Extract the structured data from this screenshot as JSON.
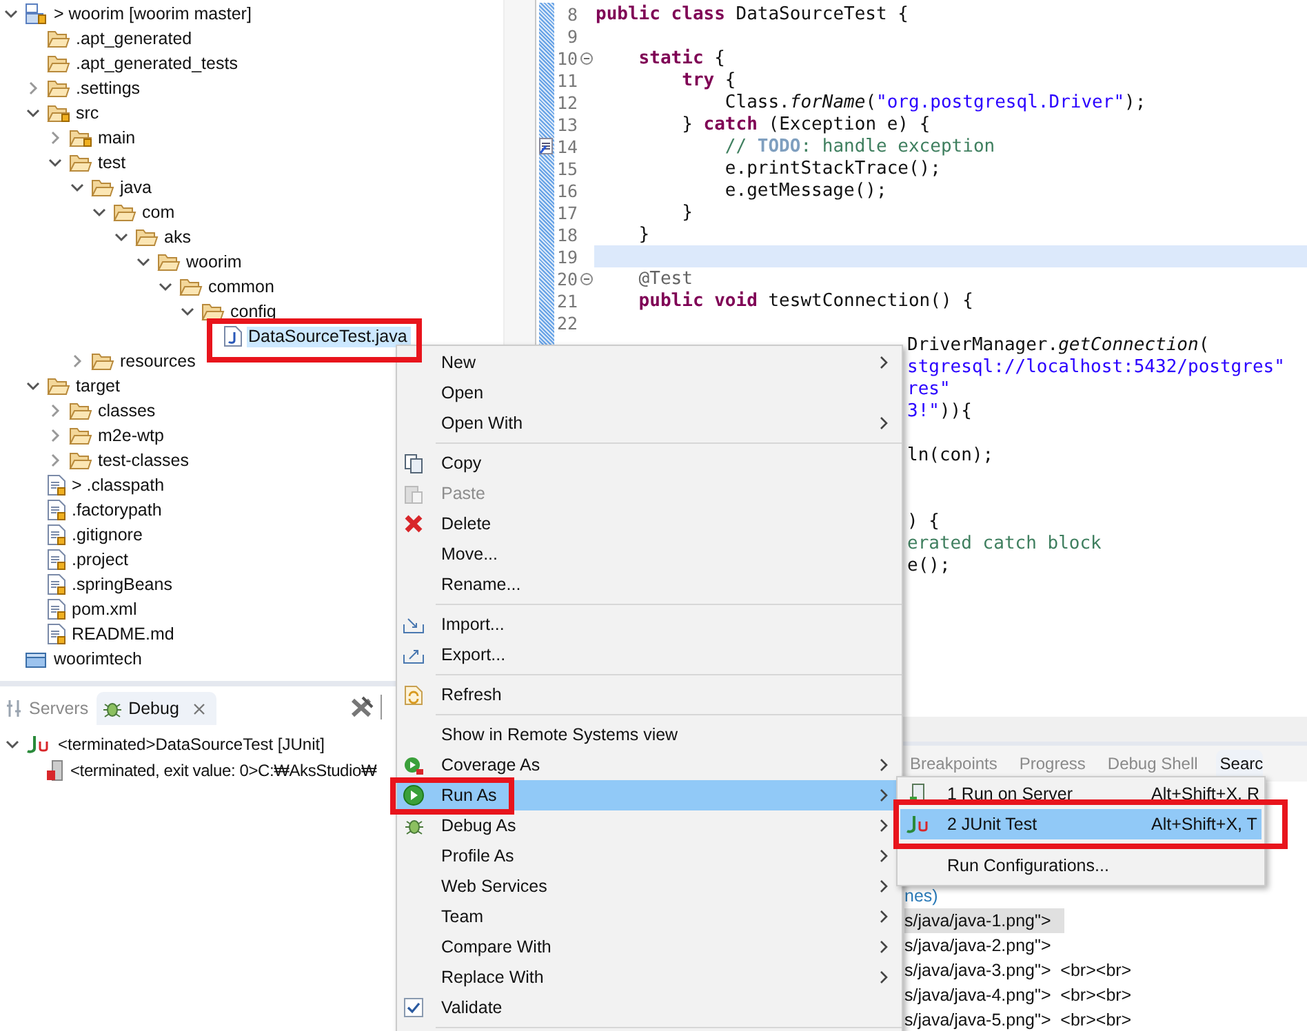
{
  "project_tree": {
    "items": [
      {
        "label": "> woorim [woorim master]",
        "kind": "project",
        "expanded": true,
        "selected": false,
        "children": [
          {
            "label": ".apt_generated",
            "kind": "folder",
            "selected": false
          },
          {
            "label": ".apt_generated_tests",
            "kind": "folder",
            "selected": false
          },
          {
            "label": ".settings",
            "kind": "folder",
            "expanded": false,
            "selected": false
          },
          {
            "label": "src",
            "kind": "source-folder",
            "expanded": true,
            "selected": false,
            "children": [
              {
                "label": "main",
                "kind": "source-folder",
                "expanded": false,
                "selected": false
              },
              {
                "label": "test",
                "kind": "folder",
                "expanded": true,
                "selected": false,
                "children": [
                  {
                    "label": "java",
                    "kind": "folder",
                    "expanded": true,
                    "selected": false,
                    "children": [
                      {
                        "label": "com",
                        "kind": "folder",
                        "expanded": true,
                        "selected": false,
                        "children": [
                          {
                            "label": "aks",
                            "kind": "folder",
                            "expanded": true,
                            "selected": false,
                            "children": [
                              {
                                "label": "woorim",
                                "kind": "folder",
                                "expanded": true,
                                "selected": false,
                                "children": [
                                  {
                                    "label": "common",
                                    "kind": "folder",
                                    "expanded": true,
                                    "selected": false,
                                    "children": [
                                      {
                                        "label": "config",
                                        "kind": "folder",
                                        "expanded": true,
                                        "selected": false,
                                        "children": [
                                          {
                                            "label": "DataSourceTest.java",
                                            "kind": "java-file",
                                            "selected": true
                                          }
                                        ]
                                      }
                                    ]
                                  }
                                ]
                              }
                            ]
                          }
                        ]
                      }
                    ]
                  },
                  {
                    "label": "resources",
                    "kind": "folder",
                    "expanded": false,
                    "selected": false
                  }
                ]
              }
            ]
          },
          {
            "label": "target",
            "kind": "folder",
            "expanded": true,
            "selected": false,
            "children": [
              {
                "label": "classes",
                "kind": "folder",
                "expanded": false,
                "selected": false
              },
              {
                "label": "m2e-wtp",
                "kind": "folder",
                "expanded": false,
                "selected": false
              },
              {
                "label": "test-classes",
                "kind": "folder",
                "expanded": false,
                "selected": false
              }
            ]
          },
          {
            "label": "> .classpath",
            "kind": "file",
            "selected": false
          },
          {
            "label": ".factorypath",
            "kind": "file",
            "selected": false
          },
          {
            "label": ".gitignore",
            "kind": "file",
            "selected": false
          },
          {
            "label": ".project",
            "kind": "file",
            "selected": false
          },
          {
            "label": ".springBeans",
            "kind": "file",
            "selected": false
          },
          {
            "label": "pom.xml",
            "kind": "file",
            "selected": false
          },
          {
            "label": "README.md",
            "kind": "file",
            "selected": false
          }
        ]
      },
      {
        "label": "woorimtech",
        "kind": "closed-project",
        "selected": false
      }
    ]
  },
  "debug_view": {
    "tabs": [
      {
        "label": "Servers",
        "selected": false,
        "closable": false
      },
      {
        "label": "Debug",
        "selected": true,
        "closable": true
      }
    ],
    "items": [
      {
        "label": "<terminated>DataSourceTest [JUnit]",
        "kind": "junit",
        "expanded": true,
        "children": [
          {
            "label": "<terminated, exit value: 0>C:₩AksStudio₩",
            "kind": "process"
          }
        ]
      }
    ]
  },
  "editor": {
    "lines": [
      {
        "number": "8",
        "current": false,
        "segments": [
          {
            "kind": "kw",
            "text": "public class"
          },
          {
            "kind": "plain",
            "text": " DataSourceTest {"
          }
        ]
      },
      {
        "number": "9",
        "current": false
      },
      {
        "number": "10",
        "current": false,
        "fold": true,
        "segments": [
          {
            "kind": "kw",
            "text": "    static"
          },
          {
            "kind": "plain",
            "text": " {"
          }
        ]
      },
      {
        "number": "11",
        "current": false,
        "segments": [
          {
            "kind": "kw",
            "text": "        try"
          },
          {
            "kind": "plain",
            "text": " {"
          }
        ]
      },
      {
        "number": "12",
        "current": false,
        "segments": [
          {
            "kind": "plain",
            "text": "            Class."
          },
          {
            "kind": "italic",
            "text": "forName"
          },
          {
            "kind": "plain",
            "text": "("
          },
          {
            "kind": "str",
            "text": "\"org.postgresql.Driver\""
          },
          {
            "kind": "plain",
            "text": ");"
          }
        ]
      },
      {
        "number": "13",
        "current": false,
        "segments": [
          {
            "kind": "plain",
            "text": "        } "
          },
          {
            "kind": "kw",
            "text": "catch"
          },
          {
            "kind": "plain",
            "text": " (Exception e) {"
          }
        ]
      },
      {
        "number": "14",
        "current": false,
        "task": true,
        "segments": [
          {
            "kind": "comment",
            "text": "            // "
          },
          {
            "kind": "todo",
            "text": "TODO"
          },
          {
            "kind": "comment",
            "text": ": handle exception"
          }
        ]
      },
      {
        "number": "15",
        "current": false,
        "segments": [
          {
            "kind": "plain",
            "text": "            e.printStackTrace();"
          }
        ]
      },
      {
        "number": "16",
        "current": false,
        "segments": [
          {
            "kind": "plain",
            "text": "            e.getMessage();"
          }
        ]
      },
      {
        "number": "17",
        "current": false,
        "segments": [
          {
            "kind": "plain",
            "text": "        }"
          }
        ]
      },
      {
        "number": "18",
        "current": false,
        "segments": [
          {
            "kind": "plain",
            "text": "    }"
          }
        ]
      },
      {
        "number": "19",
        "current": true
      },
      {
        "number": "20",
        "current": false,
        "fold": true,
        "segments": [
          {
            "kind": "annotation",
            "text": "    @Test"
          }
        ]
      },
      {
        "number": "21",
        "current": false,
        "segments": [
          {
            "kind": "kw",
            "text": "    public void"
          },
          {
            "kind": "plain",
            "text": " teswtConnection() {"
          }
        ]
      },
      {
        "number": "22",
        "current": false
      },
      {
        "kind": "clipped",
        "segments": [
          {
            "kind": "plain",
            "text": "DriverManager."
          },
          {
            "kind": "italic",
            "text": "getConnection"
          },
          {
            "kind": "plain",
            "text": "("
          }
        ]
      },
      {
        "kind": "clipped",
        "segments": [
          {
            "kind": "str",
            "text": "stgresql://localhost:5432/postgres\""
          }
        ]
      },
      {
        "kind": "clipped",
        "segments": [
          {
            "kind": "str",
            "text": "res\""
          }
        ]
      },
      {
        "kind": "clipped",
        "segments": [
          {
            "kind": "str",
            "text": "3!\""
          },
          {
            "kind": "plain",
            "text": ")){"
          }
        ]
      },
      {
        "kind": "blank"
      },
      {
        "kind": "clipped",
        "segments": [
          {
            "kind": "plain",
            "text": "ln(con);"
          }
        ]
      },
      {
        "kind": "blank"
      },
      {
        "kind": "blank"
      },
      {
        "kind": "clipped",
        "segments": [
          {
            "kind": "plain",
            "text": ") {"
          }
        ]
      },
      {
        "kind": "clipped",
        "segments": [
          {
            "kind": "comment",
            "text": "erated catch block"
          }
        ]
      },
      {
        "kind": "clipped",
        "segments": [
          {
            "kind": "plain",
            "text": "e();"
          }
        ]
      }
    ]
  },
  "bottom_panel": {
    "tabs": [
      {
        "label": "Breakpoints",
        "selected": false
      },
      {
        "label": "Progress",
        "selected": false
      },
      {
        "label": "Debug Shell",
        "selected": false
      },
      {
        "label": "Searc",
        "selected": true
      }
    ],
    "lines": [
      {
        "text": "nes)",
        "kind": "link",
        "highlighted": false
      },
      {
        "text": "s/java/java-1.png\">",
        "kind": "plain",
        "highlighted": true
      },
      {
        "text": "s/java/java-2.png\">",
        "kind": "plain",
        "highlighted": false
      },
      {
        "text": "s/java/java-3.png\">  <br><br>",
        "kind": "plain",
        "highlighted": false
      },
      {
        "text": "s/java/java-4.png\">  <br><br>",
        "kind": "plain",
        "highlighted": false
      },
      {
        "text": "s/java/java-5.png\">  <br><br>",
        "kind": "plain",
        "highlighted": false
      }
    ]
  },
  "context_menu": {
    "items": [
      {
        "kind": "plain",
        "label": "New",
        "submenu": true,
        "disabled": false,
        "selected": false
      },
      {
        "kind": "plain",
        "label": "Open",
        "submenu": false,
        "disabled": false,
        "selected": false
      },
      {
        "kind": "plain",
        "label": "Open With",
        "submenu": true,
        "disabled": false,
        "selected": false
      },
      {
        "kind": "separator"
      },
      {
        "kind": "copy",
        "label": "Copy",
        "submenu": false,
        "disabled": false,
        "selected": false
      },
      {
        "kind": "paste",
        "label": "Paste",
        "submenu": false,
        "disabled": true,
        "selected": false
      },
      {
        "kind": "delete",
        "label": "Delete",
        "submenu": false,
        "disabled": false,
        "selected": false
      },
      {
        "kind": "plain",
        "label": "Move...",
        "submenu": false,
        "disabled": false,
        "selected": false
      },
      {
        "kind": "plain",
        "label": "Rename...",
        "submenu": false,
        "disabled": false,
        "selected": false
      },
      {
        "kind": "separator"
      },
      {
        "kind": "import",
        "label": "Import...",
        "submenu": false,
        "disabled": false,
        "selected": false
      },
      {
        "kind": "export",
        "label": "Export...",
        "submenu": false,
        "disabled": false,
        "selected": false
      },
      {
        "kind": "separator"
      },
      {
        "kind": "refresh",
        "label": "Refresh",
        "submenu": false,
        "disabled": false,
        "selected": false
      },
      {
        "kind": "separator"
      },
      {
        "kind": "plain",
        "label": "Show in Remote Systems view",
        "submenu": false,
        "disabled": false,
        "selected": false
      },
      {
        "kind": "coverage",
        "label": "Coverage As",
        "submenu": true,
        "disabled": false,
        "selected": false
      },
      {
        "kind": "run",
        "label": "Run As",
        "submenu": true,
        "disabled": false,
        "selected": true
      },
      {
        "kind": "debug",
        "label": "Debug As",
        "submenu": true,
        "disabled": false,
        "selected": false
      },
      {
        "kind": "plain",
        "label": "Profile As",
        "submenu": true,
        "disabled": false,
        "selected": false
      },
      {
        "kind": "plain",
        "label": "Web Services",
        "submenu": true,
        "disabled": false,
        "selected": false
      },
      {
        "kind": "plain",
        "label": "Team",
        "submenu": true,
        "disabled": false,
        "selected": false
      },
      {
        "kind": "plain",
        "label": "Compare With",
        "submenu": true,
        "disabled": false,
        "selected": false
      },
      {
        "kind": "plain",
        "label": "Replace With",
        "submenu": true,
        "disabled": false,
        "selected": false
      },
      {
        "kind": "check",
        "label": "Validate",
        "submenu": false,
        "disabled": false,
        "selected": false,
        "checked": true
      },
      {
        "kind": "separator"
      }
    ]
  },
  "run_as_submenu": {
    "items": [
      {
        "kind": "server",
        "label": "1 Run on Server",
        "shortcut": "Alt+Shift+X, R",
        "selected": false
      },
      {
        "kind": "junit",
        "label": "2 JUnit Test",
        "shortcut": "Alt+Shift+X, T",
        "selected": true
      },
      {
        "kind": "separator"
      },
      {
        "kind": "plain",
        "label": "Run Configurations...",
        "selected": false
      }
    ]
  }
}
